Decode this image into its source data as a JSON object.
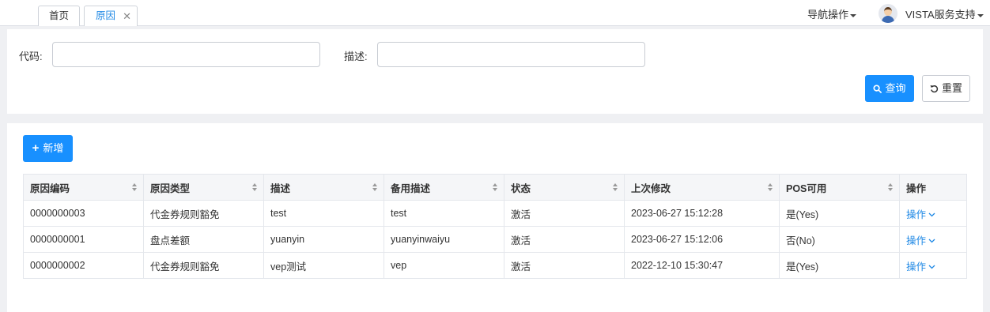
{
  "tabs": [
    {
      "label": "首页"
    },
    {
      "label": "原因",
      "close": "✕"
    }
  ],
  "header": {
    "nav_ops": "导航操作",
    "user": "VISTA服务支持"
  },
  "search": {
    "code_label": "代码:",
    "code_value": "",
    "desc_label": "描述:",
    "desc_value": "",
    "query_button": "查询",
    "reset_button": "重置"
  },
  "toolbar": {
    "add_button": "新增"
  },
  "table": {
    "columns": [
      "原因编码",
      "原因类型",
      "描述",
      "备用描述",
      "状态",
      "上次修改",
      "POS可用",
      "操作"
    ],
    "rows": [
      [
        "0000000003",
        "代金券规则豁免",
        "test",
        "test",
        "激活",
        "2023-06-27 15:12:28",
        "是(Yes)",
        "操作"
      ],
      [
        "0000000001",
        "盘点差额",
        "yuanyin",
        "yuanyinwaiyu",
        "激活",
        "2023-06-27 15:12:06",
        "否(No)",
        "操作"
      ],
      [
        "0000000002",
        "代金券规则豁免",
        "vep测试",
        "vep",
        "激活",
        "2022-12-10 15:30:47",
        "是(Yes)",
        "操作"
      ]
    ]
  },
  "colors": {
    "primary": "#1890ff",
    "link": "#1e88e5",
    "background": "#eff0f3"
  },
  "icons": [
    "close-icon",
    "caret-down-icon",
    "avatar-icon",
    "search-icon",
    "reset-icon",
    "plus-icon",
    "sort-icon",
    "chevron-down-icon"
  ]
}
